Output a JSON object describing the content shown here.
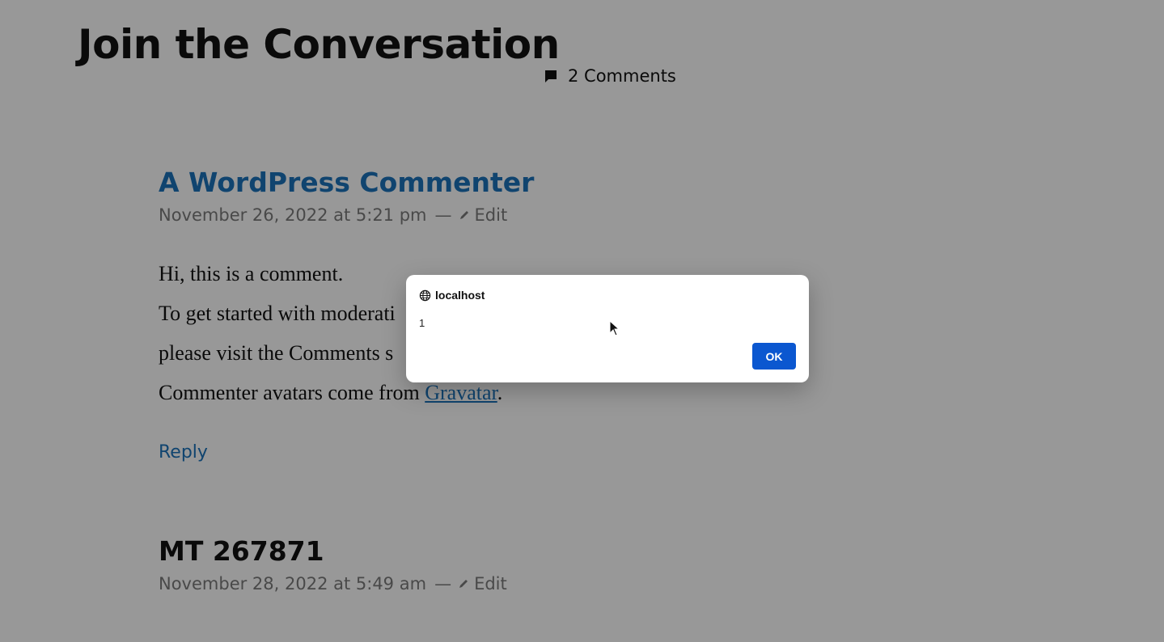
{
  "page": {
    "title": "Join the Conversation",
    "comments_count": "2 Comments"
  },
  "comments": [
    {
      "author": "A WordPress Commenter",
      "date": "November 26, 2022 at 5:21 pm",
      "dash": "—",
      "edit_label": "Edit",
      "body": {
        "line1": "Hi, this is a comment.",
        "line2": "To get started with moderati",
        "line3": "please visit the Comments s",
        "line4_prefix": "Commenter avatars come from ",
        "line4_link": "Gravatar",
        "line4_suffix": "."
      },
      "reply_label": "Reply"
    },
    {
      "author": "MT 267871",
      "date": "November 28, 2022 at 5:49 am",
      "dash": "—",
      "edit_label": "Edit"
    }
  ],
  "dialog": {
    "origin": "localhost",
    "message": "1",
    "ok_label": "OK"
  },
  "icons": {
    "comment": "speech-bubble-icon",
    "edit": "pencil-icon",
    "globe": "globe-icon",
    "cursor": "mouse-pointer-icon"
  },
  "colors": {
    "link": "#1a6fb3",
    "ok_button": "#0b57d0",
    "overlay": "rgba(0,0,0,0.38)"
  }
}
